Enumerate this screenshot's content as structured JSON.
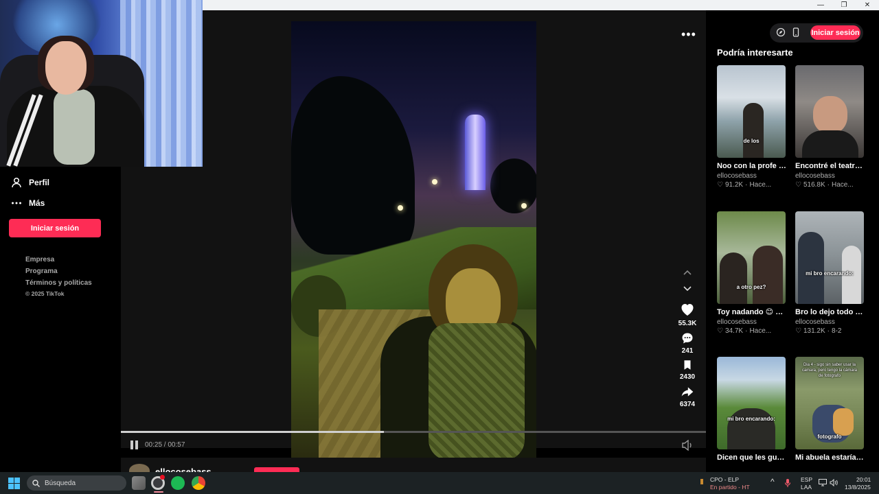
{
  "sidebar": {
    "items": [
      {
        "label": "Perfil",
        "icon": "user-icon"
      },
      {
        "label": "Más",
        "icon": "more-icon"
      }
    ],
    "login_label": "Iniciar sesión",
    "footer": [
      "Empresa",
      "Programa",
      "Términos y políticas"
    ],
    "copyright": "© 2025 TikTok"
  },
  "player": {
    "time": "00:25 / 00:57",
    "progress": 0.45,
    "likes": "55.3K",
    "comments": "241",
    "saves": "2430",
    "shares": "6374",
    "author": "ellocosebass"
  },
  "right": {
    "login_label": "Iniciar sesión",
    "title": "Podría interesarte",
    "cards": [
      {
        "title": "Noo con la profe no 🗿 #humor #brom...",
        "author": "ellocosebass",
        "likes": "91.2K",
        "when": "Hace...",
        "caption": "de los"
      },
      {
        "title": "Encontré el teatro 🗿 #humor #brom...",
        "author": "ellocosebass",
        "likes": "516.8K",
        "when": "Hace...",
        "caption": ""
      },
      {
        "title": "Toy nadando 😊 #humor #broma...",
        "author": "ellocosebass",
        "likes": "34.7K",
        "when": "Hace...",
        "caption": "a otro pez?"
      },
      {
        "title": "Bro lo dejo todo 🥶 #humor #broma...",
        "author": "ellocosebass",
        "likes": "131.2K",
        "when": "8-2",
        "caption": "mi bro encarando:"
      },
      {
        "title": "Dicen que les guste? 😊 #viral #broma...",
        "author": "",
        "likes": "",
        "when": "",
        "caption": "mi bro encarando:"
      },
      {
        "title": "Mi abuela estaría orgullosa 🗿 #hum...",
        "author": "",
        "likes": "",
        "when": "",
        "caption": "fotografo"
      }
    ],
    "card6_top_caption": "Dia 4 - sigo sin saber usar la camara, pero tengo la cámara de fotografo"
  },
  "taskbar": {
    "search_placeholder": "Búsqueda",
    "match": "CPO - ELP",
    "match_status": "En partido - HT",
    "lang": "ESP",
    "lang2": "LAA",
    "time": "20:01",
    "date": "13/8/2025"
  },
  "colors": {
    "accent": "#fe2c55",
    "panel": "#121212"
  }
}
